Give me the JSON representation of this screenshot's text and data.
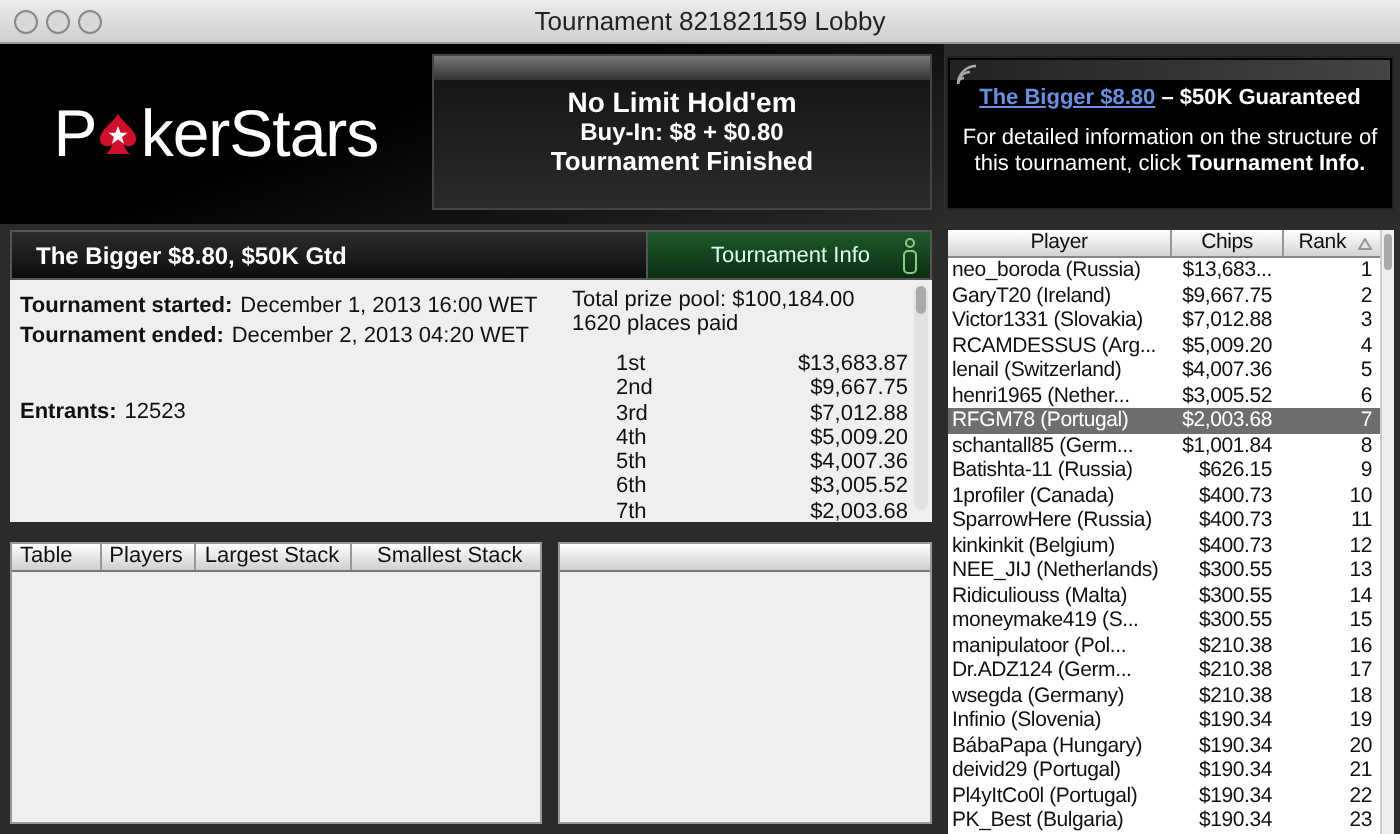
{
  "window": {
    "title": "Tournament 821821159 Lobby"
  },
  "logo": {
    "before": "P",
    "after": "kerStars"
  },
  "game": {
    "name": "No Limit Hold'em",
    "buy_in": "Buy-In: $8 + $0.80",
    "status": "Tournament Finished"
  },
  "promo": {
    "link": "The Bigger $8.80",
    "tagline": " – $50K Guaranteed",
    "text": "For detailed information on the structure of this tournament, click **Tournament Info.**"
  },
  "summary": {
    "title": "The Bigger $8.80, $50K Gtd",
    "info_button": "Tournament Info",
    "details": [
      {
        "label": "Tournament started:",
        "value": "December 1, 2013 16:00 WET"
      },
      {
        "label": "Tournament ended:",
        "value": "December 2, 2013 04:20 WET"
      },
      {
        "label": "Entrants:",
        "value": "12523"
      }
    ],
    "prize_pool": "Total prize pool: $100,184.00",
    "places_paid": "1620 places paid",
    "prizes": [
      {
        "place": "1st",
        "amount": "$13,683.87"
      },
      {
        "place": "2nd",
        "amount": "$9,667.75"
      },
      {
        "place": "3rd",
        "amount": "$7,012.88"
      },
      {
        "place": "4th",
        "amount": "$5,009.20"
      },
      {
        "place": "5th",
        "amount": "$4,007.36"
      },
      {
        "place": "6th",
        "amount": "$3,005.52"
      },
      {
        "place": "7th",
        "amount": "$2,003.68"
      }
    ]
  },
  "tables": {
    "columns": [
      "Table",
      "Players",
      "Largest Stack",
      "Smallest Stack"
    ]
  },
  "players": {
    "columns": [
      "Player",
      "Chips",
      "Rank"
    ],
    "rows": [
      {
        "player": "neo_boroda (Russia)",
        "chips": "$13,683...",
        "rank": "1",
        "selected": false
      },
      {
        "player": "GaryT20 (Ireland)",
        "chips": "$9,667.75",
        "rank": "2",
        "selected": false
      },
      {
        "player": "Victor1331 (Slovakia)",
        "chips": "$7,012.88",
        "rank": "3",
        "selected": false
      },
      {
        "player": "RCAMDESSUS (Arg...",
        "chips": "$5,009.20",
        "rank": "4",
        "selected": false
      },
      {
        "player": "lenail (Switzerland)",
        "chips": "$4,007.36",
        "rank": "5",
        "selected": false
      },
      {
        "player": "henri1965 (Nether...",
        "chips": "$3,005.52",
        "rank": "6",
        "selected": false
      },
      {
        "player": "RFGM78 (Portugal)",
        "chips": "$2,003.68",
        "rank": "7",
        "selected": true
      },
      {
        "player": "schantall85 (Germ...",
        "chips": "$1,001.84",
        "rank": "8",
        "selected": false
      },
      {
        "player": "Batishta-11 (Russia)",
        "chips": "$626.15",
        "rank": "9",
        "selected": false
      },
      {
        "player": "1profiler (Canada)",
        "chips": "$400.73",
        "rank": "10",
        "selected": false
      },
      {
        "player": "SparrowHere (Russia)",
        "chips": "$400.73",
        "rank": "11",
        "selected": false
      },
      {
        "player": "kinkinkit (Belgium)",
        "chips": "$400.73",
        "rank": "12",
        "selected": false
      },
      {
        "player": "NEE_JIJ (Netherlands)",
        "chips": "$300.55",
        "rank": "13",
        "selected": false
      },
      {
        "player": "Ridiculiouss (Malta)",
        "chips": "$300.55",
        "rank": "14",
        "selected": false
      },
      {
        "player": "moneymake419 (S...",
        "chips": "$300.55",
        "rank": "15",
        "selected": false
      },
      {
        "player": "manipulatoor (Pol...",
        "chips": "$210.38",
        "rank": "16",
        "selected": false
      },
      {
        "player": "Dr.ADZ124 (Germ...",
        "chips": "$210.38",
        "rank": "17",
        "selected": false
      },
      {
        "player": "wsegda (Germany)",
        "chips": "$210.38",
        "rank": "18",
        "selected": false
      },
      {
        "player": "Infinio (Slovenia)",
        "chips": "$190.34",
        "rank": "19",
        "selected": false
      },
      {
        "player": "BábaPapa (Hungary)",
        "chips": "$190.34",
        "rank": "20",
        "selected": false
      },
      {
        "player": "deivid29 (Portugal)",
        "chips": "$190.34",
        "rank": "21",
        "selected": false
      },
      {
        "player": "Pl4yItCo0l (Portugal)",
        "chips": "$190.34",
        "rank": "22",
        "selected": false
      },
      {
        "player": "PK_Best (Bulgaria)",
        "chips": "$190.34",
        "rank": "23",
        "selected": false
      }
    ]
  }
}
